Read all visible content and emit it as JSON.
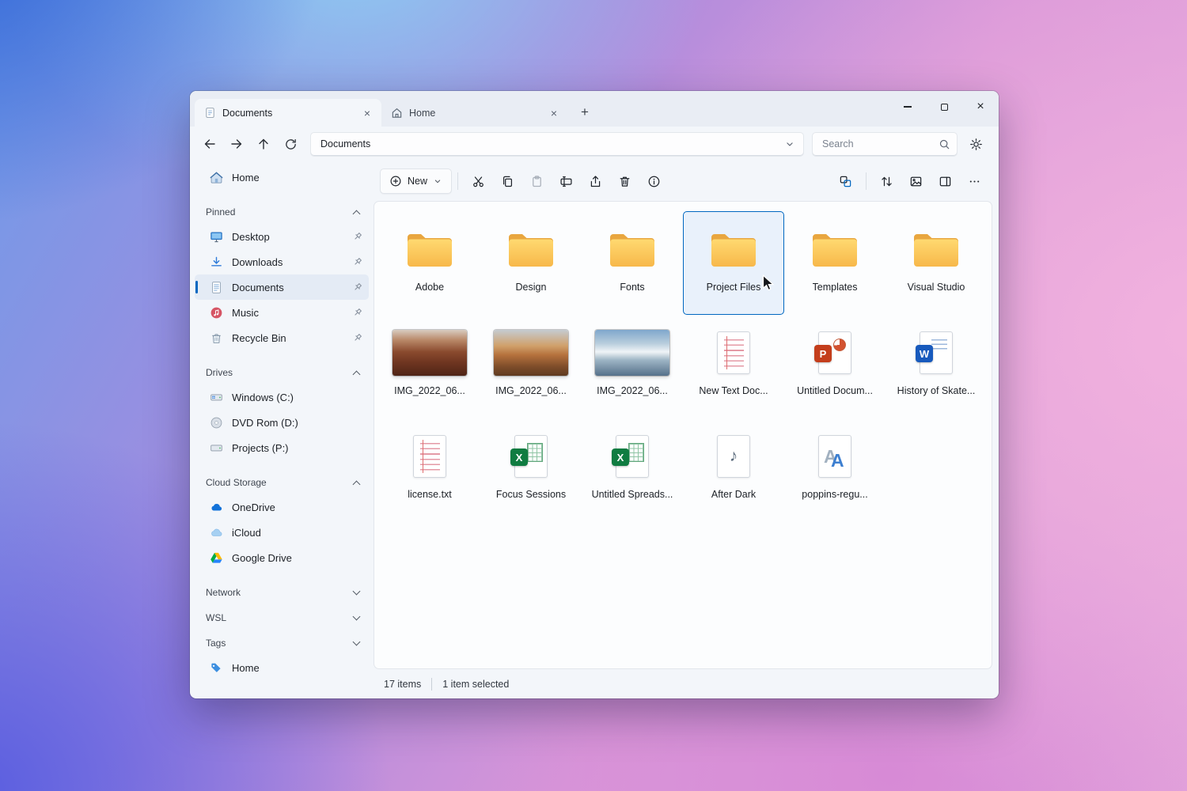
{
  "window": {
    "tabs": [
      {
        "label": "Documents"
      },
      {
        "label": "Home"
      }
    ]
  },
  "navigation": {
    "address": "Documents",
    "search_placeholder": "Search"
  },
  "commandbar": {
    "new_label": "New"
  },
  "sidebar": {
    "home_label": "Home",
    "pinned_header": "Pinned",
    "pinned": [
      "Desktop",
      "Downloads",
      "Documents",
      "Music",
      "Recycle Bin"
    ],
    "drives_header": "Drives",
    "drives": [
      "Windows (C:)",
      "DVD Rom (D:)",
      "Projects (P:)"
    ],
    "cloud_header": "Cloud Storage",
    "cloud": [
      "OneDrive",
      "iCloud",
      "Google Drive"
    ],
    "network_header": "Network",
    "wsl_header": "WSL",
    "tags_header": "Tags",
    "tag_home_label": "Home"
  },
  "grid": {
    "items": [
      {
        "name": "Adobe",
        "type": "folder"
      },
      {
        "name": "Design",
        "type": "folder"
      },
      {
        "name": "Fonts",
        "type": "folder"
      },
      {
        "name": "Project Files",
        "type": "folder",
        "selected": true
      },
      {
        "name": "Templates",
        "type": "folder"
      },
      {
        "name": "Visual Studio",
        "type": "folder"
      },
      {
        "name": "IMG_2022_06...",
        "type": "image"
      },
      {
        "name": "IMG_2022_06...",
        "type": "image"
      },
      {
        "name": "IMG_2022_06...",
        "type": "image"
      },
      {
        "name": "New Text Doc...",
        "type": "text"
      },
      {
        "name": "Untitled Docum...",
        "type": "powerpoint"
      },
      {
        "name": "History of Skate...",
        "type": "word"
      },
      {
        "name": "license.txt",
        "type": "text"
      },
      {
        "name": "Focus Sessions",
        "type": "excel"
      },
      {
        "name": "Untitled Spreads...",
        "type": "excel"
      },
      {
        "name": "After Dark",
        "type": "audio"
      },
      {
        "name": "poppins-regu...",
        "type": "font"
      }
    ]
  },
  "statusbar": {
    "count": "17 items",
    "selected": "1 item selected"
  },
  "icons": {
    "word_badge": "W",
    "excel_badge": "X",
    "powerpoint_badge": "P",
    "audio_note": "♪",
    "font_glyph": "A"
  },
  "colors": {
    "accent": "#0067c0",
    "folder": "#f7b84a",
    "selection_fill": "#e9f1fb"
  }
}
